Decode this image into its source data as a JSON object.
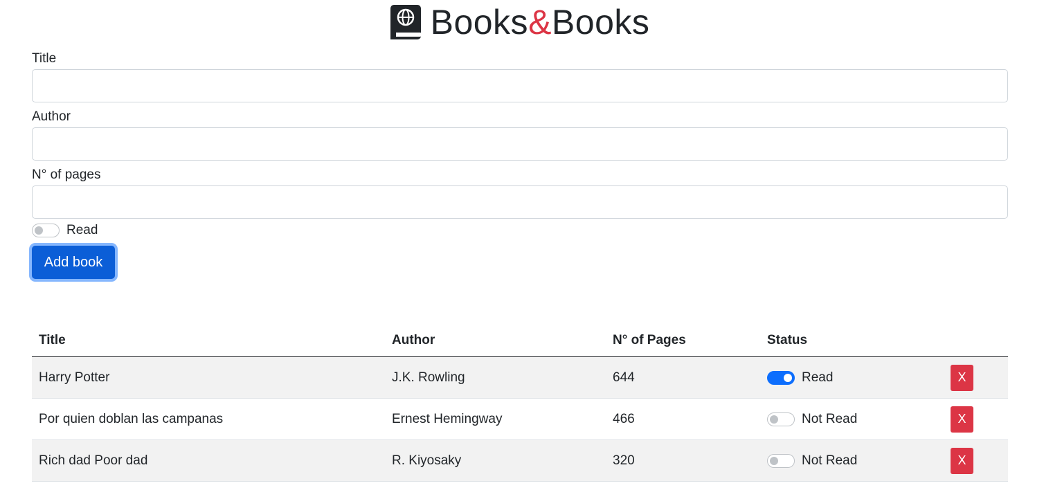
{
  "brand": {
    "icon": "book-globe-icon",
    "name_part1": "Books",
    "ampersand": "&",
    "name_part2": "Books",
    "accent_color": "#dc3545"
  },
  "form": {
    "title_label": "Title",
    "title_value": "",
    "author_label": "Author",
    "author_value": "",
    "pages_label": "N° of pages",
    "pages_value": "",
    "read_label": "Read",
    "read_checked": false,
    "submit_label": "Add book",
    "primary_color": "#0b5ed7"
  },
  "table": {
    "headers": {
      "title": "Title",
      "author": "Author",
      "pages": "N° of Pages",
      "status": "Status"
    },
    "rows": [
      {
        "title": "Harry Potter",
        "author": "J.K. Rowling",
        "pages": "644",
        "status": "Read",
        "read": true,
        "delete_label": "X"
      },
      {
        "title": "Por quien doblan las campanas",
        "author": "Ernest Hemingway",
        "pages": "466",
        "status": "Not Read",
        "read": false,
        "delete_label": "X"
      },
      {
        "title": "Rich dad Poor dad",
        "author": "R. Kiyosaky",
        "pages": "320",
        "status": "Not Read",
        "read": false,
        "delete_label": "X"
      }
    ],
    "delete_color": "#dc3545"
  }
}
